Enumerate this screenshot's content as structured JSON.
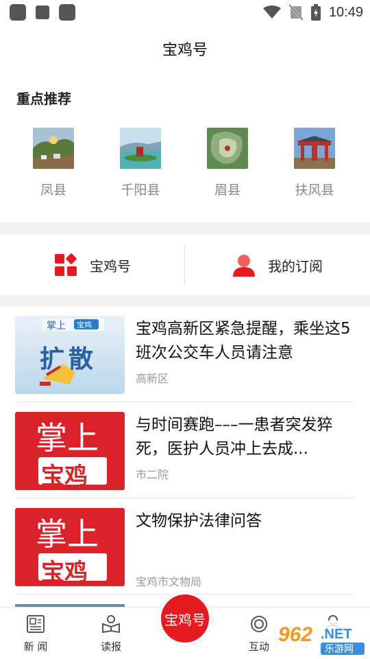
{
  "status_bar": {
    "time": "10:49",
    "icons": [
      "notification-square-icon",
      "notification-square-icon",
      "notification-square-icon",
      "wifi-icon",
      "no-signal-icon",
      "battery-charging-icon"
    ]
  },
  "header": {
    "title": "宝鸡号"
  },
  "recommended": {
    "heading": "重点推荐",
    "items": [
      {
        "label": "凤县"
      },
      {
        "label": "千阳县"
      },
      {
        "label": "眉县"
      },
      {
        "label": "扶风县"
      }
    ]
  },
  "tabs": {
    "left": {
      "label": "宝鸡号",
      "icon": "grid-diamond-icon"
    },
    "right": {
      "label": "我的订阅",
      "icon": "user-icon"
    }
  },
  "news": [
    {
      "title": "宝鸡高新区紧急提醒，乘坐这5班次公交车人员请注意",
      "source": "高新区",
      "thumb_top": "掌上",
      "thumb_badge": "宝鸡",
      "thumb_main": "扩散"
    },
    {
      "title": "与时间赛跑–––一患者突发猝死，医护人员冲上去成...",
      "source": "市二院",
      "thumb_top": "掌上",
      "thumb_main": "宝鸡"
    },
    {
      "title": "文物保护法律问答",
      "source": "宝鸡市文物局",
      "thumb_top": "掌上",
      "thumb_main": "宝鸡"
    }
  ],
  "bottom_nav": {
    "items": [
      {
        "label": "新 闻",
        "icon": "newspaper-icon"
      },
      {
        "label": "读报",
        "icon": "reader-icon"
      },
      {
        "label": "互动",
        "icon": "interaction-icon"
      }
    ],
    "center_label": "宝鸡号"
  },
  "watermark": {
    "text1": "962.NET",
    "text2": "乐游网"
  },
  "colors": {
    "accent": "#e31a1f",
    "muted_text": "#888888",
    "background_band": "#f2f2f2"
  }
}
